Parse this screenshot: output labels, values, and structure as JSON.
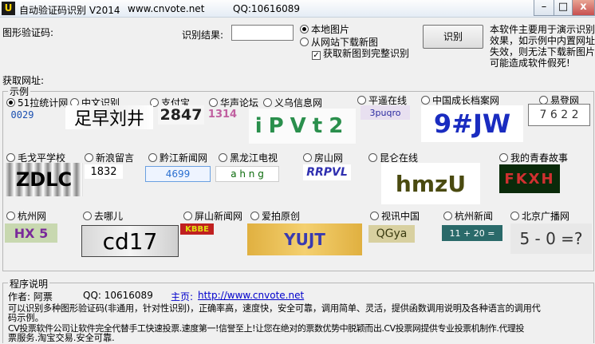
{
  "window": {
    "title": "自动验证码识别 V2014",
    "site": "www.cnvote.net",
    "qq": "QQ:10616089",
    "icon_letter": "U",
    "minimize": "–",
    "maximize": "□",
    "close": "x"
  },
  "form": {
    "captcha_label": "图形验证码:",
    "result_label": "识别结果:",
    "result_value": "",
    "radio_local": "本地图片",
    "radio_web": "从网站下载新图",
    "checkbox_full": "获取新图到完整识别",
    "recognize_button": "识别",
    "url_label": "获取网址:",
    "description": [
      "本软件主要用于演示识别",
      "效果，如示例中内置网址",
      "失效，则无法下载新图片",
      "可能造成软件假死!"
    ]
  },
  "samples": {
    "group_label": "示例",
    "items": [
      {
        "name": "51拉统计网",
        "selected": true,
        "captcha": "0029"
      },
      {
        "name": "中文识别",
        "selected": false,
        "captcha": "足早刘井"
      },
      {
        "name": "支付宝",
        "selected": false,
        "captcha": "2847"
      },
      {
        "name": "华声论坛",
        "selected": false,
        "captcha": "1314"
      },
      {
        "name": "义乌信息网",
        "selected": false,
        "captcha": "iPVt2"
      },
      {
        "name": "平遥在线",
        "selected": false,
        "captcha": "3puqro"
      },
      {
        "name": "中国成长档案网",
        "selected": false,
        "captcha": "9#JW"
      },
      {
        "name": "易登网",
        "selected": false,
        "captcha": "7 6 2 2"
      },
      {
        "name": "毛戈平学校",
        "selected": false,
        "captcha": "ZDLC"
      },
      {
        "name": "新浪留言",
        "selected": false,
        "captcha": "1832"
      },
      {
        "name": "黔江新闻网",
        "selected": false,
        "captcha": "4699"
      },
      {
        "name": "黑龙江电视",
        "selected": false,
        "captcha": "a h n g"
      },
      {
        "name": "房山网",
        "selected": false,
        "captcha": "RRPVL"
      },
      {
        "name": "昆仑在线",
        "selected": false,
        "captcha": "hmzU"
      },
      {
        "name": "我的青春故事",
        "selected": false,
        "captcha": "FKXH"
      },
      {
        "name": "杭州网",
        "selected": false,
        "captcha": "HX 5"
      },
      {
        "name": "去哪儿",
        "selected": false,
        "captcha": "cd17"
      },
      {
        "name": "屏山新闻网",
        "selected": false,
        "captcha": "KBBE"
      },
      {
        "name": "爱拍原创",
        "selected": false,
        "captcha": "YUJT"
      },
      {
        "name": "视讯中国",
        "selected": false,
        "captcha": "QGya"
      },
      {
        "name": "杭州新闻",
        "selected": false,
        "captcha": "11 + 20 ="
      },
      {
        "name": "北京广播网",
        "selected": false,
        "captcha": "5 - 0 =?"
      }
    ]
  },
  "program_info": {
    "group_label": "程序说明",
    "author_label": "作者: 阿票",
    "qq_label": "QQ: 10616089",
    "homepage_label": "主页:",
    "homepage_url": "http://www.cnvote.net",
    "line1": "可以识别多种图形验证码(非通用，针对性识别)，正确率高，速度快，安全可靠，调用简单、灵活，提供函数调用说明及各种语言的调用代",
    "line2": "码示例。",
    "line3": "CV投票软件公司让软件完全代替手工快速投票.速度第一!信誉至上!让您在绝对的票数优势中脱颖而出.CV投票网提供专业投票机制作.代理投",
    "line4": "票服务.淘宝交易.安全可靠."
  },
  "colors": {
    "accent_link": "#0000cc",
    "window_bg": "#f0f0f0",
    "close_button": "#c75050"
  }
}
